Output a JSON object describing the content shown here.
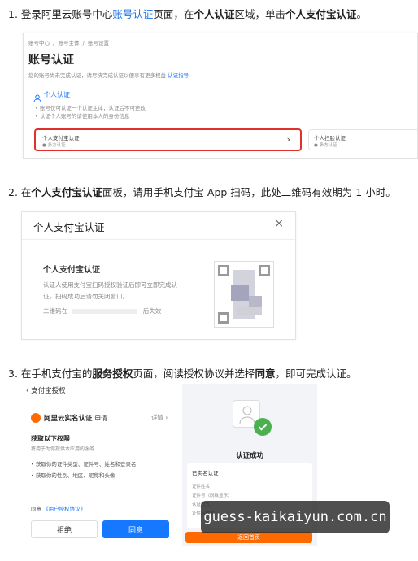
{
  "steps": {
    "s1": {
      "a": "1. 登录阿里云账号中心",
      "link": "账号认证",
      "b": "页面，在",
      "bold1": "个人认证",
      "c": "区域，单击",
      "bold2": "个人支付宝认证",
      "d": "。"
    },
    "s2": {
      "a": "2. 在",
      "bold1": "个人支付宝认证",
      "b": "面板，请用手机支付宝 App 扫码，此处二维码有效期为 1 小时。"
    },
    "s3": {
      "a": "3. 在手机支付宝的",
      "bold1": "服务授权",
      "b": "页面，阅读授权协议并选择",
      "bold2": "同意",
      "c": "，即可完成认证。"
    }
  },
  "shot1": {
    "breadcrumbs": [
      "账号中心",
      "账号主体",
      "账号设置"
    ],
    "title": "账号认证",
    "subtitle": "您的账号尚未完成认证，请尽快完成认证以便享有更多权益",
    "subtitle_link": "认证指导",
    "section": "个人认证",
    "bullets": [
      "账号仅可认证一个认证主体，认证后不可更改",
      "认证个人账号的请使用本人的身份信息"
    ],
    "card1_title": "个人支付宝认证",
    "card1_sub": "多方认证",
    "card1_arrow": "›",
    "card2_title": "个人扫脸认证",
    "card2_sub": "多方认证"
  },
  "shot2": {
    "title": "个人支付宝认证",
    "close": "×",
    "heading": "个人支付宝认证",
    "desc1": "认证人使用支付宝扫码授权验证后即可立即完成认",
    "desc2": "证，扫码成功后请勿关闭窗口。",
    "expire_a": "二维码在",
    "expire_b": "后失效"
  },
  "shot3": {
    "back": "‹  支付宝授权",
    "app_name": "阿里云实名认证",
    "app_tag": "申请",
    "detail": "详情 ›",
    "perm_title": "获取以下权限",
    "perm_sub": "将用于为你提供本应用的服务",
    "perms": [
      "获取你的证件类型、证件号、姓名和登录名",
      "获取你的性别、地区、昵称和头像"
    ],
    "agree_text": "同意",
    "agree_link": "《用户授权协议》",
    "reject": "拒绝",
    "accept": "同意",
    "success": "认证成功",
    "done_label": "已实名认证",
    "rows": [
      "证件姓名",
      "证件号（脱敏显示）",
      "认证方式",
      "证件有效期"
    ],
    "done_btn": "返回首页"
  },
  "watermark": "guess-kaikaiyun.com.cn",
  "colors": {
    "accent": "#1677ff",
    "highlight": "#e0302c",
    "success": "#4caf50",
    "orange": "#ff6a00"
  }
}
